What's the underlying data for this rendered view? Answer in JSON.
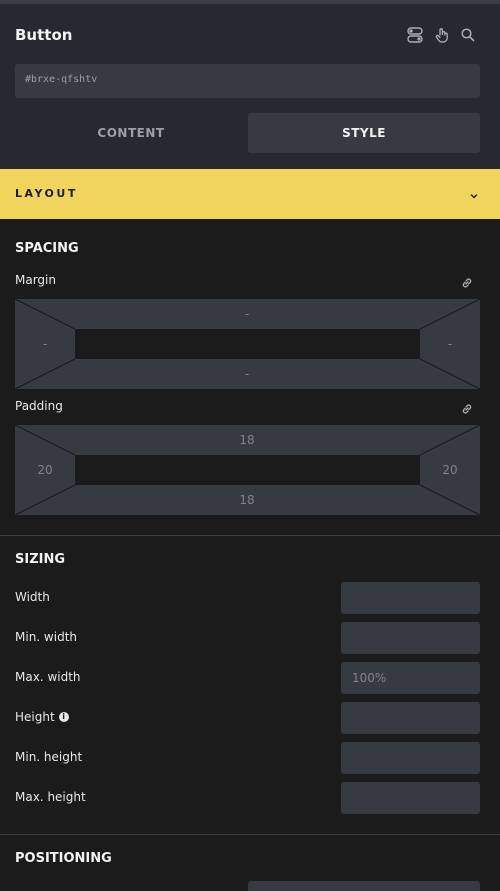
{
  "panel": {
    "title": "Button",
    "element_id": "#brxe-qfshtv",
    "icons": [
      "toggle-icon",
      "hand-pointer-icon",
      "search-icon"
    ]
  },
  "tabs": [
    {
      "label": "CONTENT",
      "active": false
    },
    {
      "label": "STYLE",
      "active": true
    }
  ],
  "layout_section": {
    "label": "LAYOUT",
    "accent": "#f0d45c"
  },
  "spacing": {
    "title": "SPACING",
    "margin": {
      "label": "Margin",
      "top": "-",
      "right": "-",
      "bottom": "-",
      "left": "-"
    },
    "padding": {
      "label": "Padding",
      "top": "18",
      "right": "20",
      "bottom": "18",
      "left": "20"
    }
  },
  "sizing": {
    "title": "SIZING",
    "rows": [
      {
        "label": "Width",
        "placeholder": ""
      },
      {
        "label": "Min. width",
        "placeholder": ""
      },
      {
        "label": "Max. width",
        "placeholder": "100%"
      },
      {
        "label": "Height",
        "placeholder": "",
        "info": true
      },
      {
        "label": "Min. height",
        "placeholder": ""
      },
      {
        "label": "Max. height",
        "placeholder": ""
      }
    ]
  },
  "positioning": {
    "title": "POSITIONING"
  },
  "colors": {
    "panel_bg": "#1b1b1b",
    "header_bg": "#262a30",
    "field_bg": "#363a41"
  }
}
